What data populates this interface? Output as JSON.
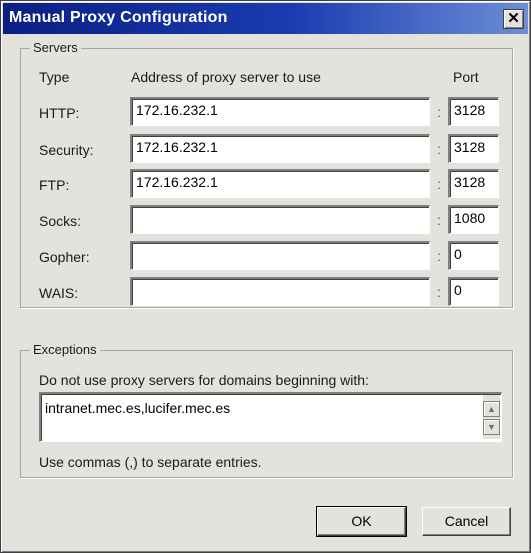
{
  "window": {
    "title": "Manual Proxy Configuration",
    "close_glyph": "✕"
  },
  "servers": {
    "group_label": "Servers",
    "col_type": "Type",
    "col_address": "Address of proxy server to use",
    "col_port": "Port",
    "separator": ":",
    "rows": [
      {
        "label": "HTTP:",
        "address": "172.16.232.1",
        "port": "3128"
      },
      {
        "label": "Security:",
        "address": "172.16.232.1",
        "port": "3128"
      },
      {
        "label": "FTP:",
        "address": "172.16.232.1",
        "port": "3128"
      },
      {
        "label": "Socks:",
        "address": "",
        "port": "1080"
      },
      {
        "label": "Gopher:",
        "address": "",
        "port": "0"
      },
      {
        "label": "WAIS:",
        "address": "",
        "port": "0"
      }
    ]
  },
  "exceptions": {
    "group_label": "Exceptions",
    "prompt": "Do not use proxy servers for domains beginning with:",
    "value": "intranet.mec.es,lucifer.mec.es",
    "hint": "Use commas (,) to separate entries.",
    "scroll_up_icon": "▲",
    "scroll_down_icon": "▼"
  },
  "buttons": {
    "ok": "OK",
    "cancel": "Cancel"
  }
}
